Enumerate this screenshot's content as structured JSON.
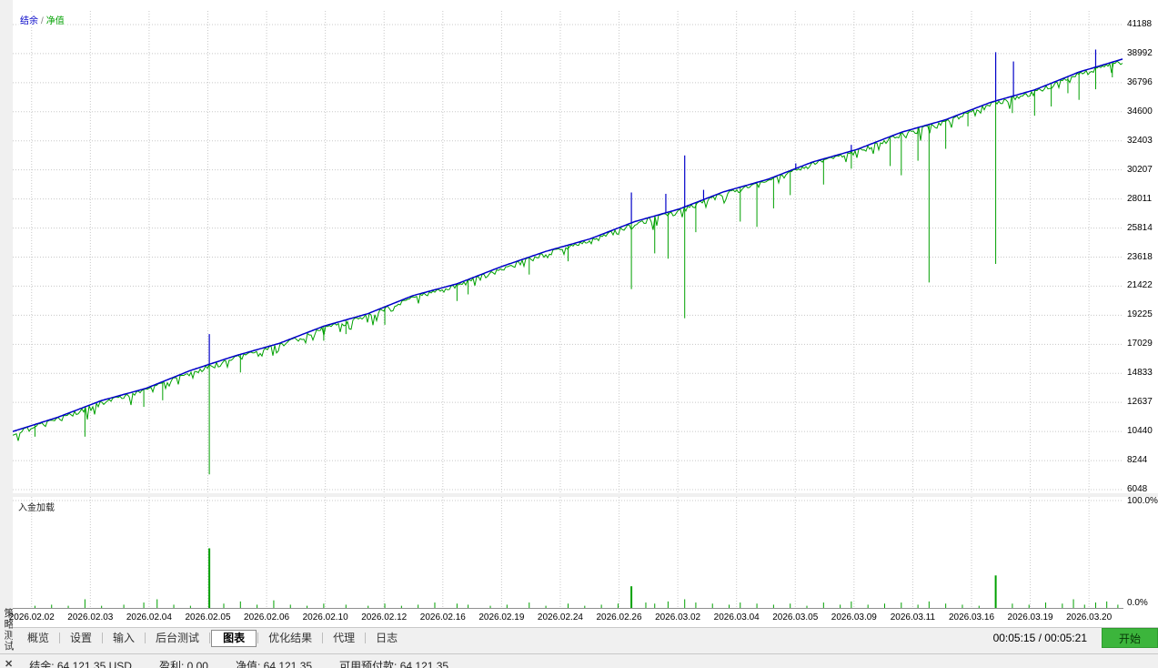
{
  "window": {
    "vertical_title": "策略测试"
  },
  "chart": {
    "legend": {
      "balance": "结余",
      "separator": "/",
      "equity": "净值"
    },
    "sub": {
      "label": "入金加载",
      "top": "100.0%",
      "bottom": "0.0%"
    }
  },
  "chart_data": [
    {
      "type": "line",
      "title": "结余 / 净值",
      "ylim": [
        6048,
        41188
      ],
      "yticks": [
        41188,
        38992,
        36796,
        34600,
        32403,
        30207,
        28011,
        25814,
        23618,
        21422,
        19225,
        17029,
        14833,
        12637,
        10440,
        8244,
        6048
      ],
      "x_labels": [
        "2026.02.02",
        "2026.02.03",
        "2026.02.04",
        "2026.02.05",
        "2026.02.06",
        "2026.02.10",
        "2026.02.12",
        "2026.02.16",
        "2026.02.19",
        "2026.02.24",
        "2026.02.26",
        "2026.03.02",
        "2026.03.04",
        "2026.03.05",
        "2026.03.09",
        "2026.03.11",
        "2026.03.16",
        "2026.03.19",
        "2026.03.20"
      ],
      "grid": true,
      "legend_position": "top-left",
      "series": [
        {
          "name": "结余",
          "color": "#0000C8",
          "points": [
            [
              0,
              10440
            ],
            [
              0.04,
              11500
            ],
            [
              0.08,
              12780
            ],
            [
              0.12,
              13700
            ],
            [
              0.16,
              15050
            ],
            [
              0.2,
              16150
            ],
            [
              0.24,
              17100
            ],
            [
              0.28,
              18400
            ],
            [
              0.32,
              19350
            ],
            [
              0.36,
              20700
            ],
            [
              0.4,
              21600
            ],
            [
              0.44,
              22900
            ],
            [
              0.48,
              24050
            ],
            [
              0.52,
              25000
            ],
            [
              0.56,
              26300
            ],
            [
              0.6,
              27250
            ],
            [
              0.64,
              28550
            ],
            [
              0.68,
              29500
            ],
            [
              0.72,
              30800
            ],
            [
              0.76,
              31750
            ],
            [
              0.8,
              33050
            ],
            [
              0.84,
              34000
            ],
            [
              0.88,
              35300
            ],
            [
              0.92,
              36250
            ],
            [
              0.96,
              37600
            ],
            [
              1,
              38600
            ]
          ],
          "up_spikes": [
            [
              0.177,
              17800
            ],
            [
              0.557,
              28500
            ],
            [
              0.588,
              28400
            ],
            [
              0.605,
              31300
            ],
            [
              0.622,
              28700
            ],
            [
              0.705,
              30700
            ],
            [
              0.755,
              32100
            ],
            [
              0.885,
              39100
            ],
            [
              0.901,
              38400
            ],
            [
              0.975,
              39300
            ]
          ]
        },
        {
          "name": "净值",
          "color": "#00A000",
          "down_spikes": [
            [
              0.02,
              10050
            ],
            [
              0.065,
              10050
            ],
            [
              0.118,
              12300
            ],
            [
              0.135,
              12800
            ],
            [
              0.177,
              7200
            ],
            [
              0.205,
              14900
            ],
            [
              0.28,
              17300
            ],
            [
              0.3,
              17800
            ],
            [
              0.335,
              18500
            ],
            [
              0.4,
              20300
            ],
            [
              0.41,
              20800
            ],
            [
              0.465,
              22300
            ],
            [
              0.5,
              23300
            ],
            [
              0.557,
              21200
            ],
            [
              0.578,
              23900
            ],
            [
              0.59,
              23500
            ],
            [
              0.605,
              19000
            ],
            [
              0.615,
              25500
            ],
            [
              0.655,
              26300
            ],
            [
              0.67,
              25900
            ],
            [
              0.685,
              27300
            ],
            [
              0.7,
              28300
            ],
            [
              0.73,
              29100
            ],
            [
              0.755,
              30300
            ],
            [
              0.79,
              30500
            ],
            [
              0.8,
              29800
            ],
            [
              0.815,
              30900
            ],
            [
              0.825,
              21700
            ],
            [
              0.84,
              31800
            ],
            [
              0.86,
              33500
            ],
            [
              0.885,
              23100
            ],
            [
              0.9,
              34500
            ],
            [
              0.92,
              34300
            ],
            [
              0.935,
              35000
            ],
            [
              0.95,
              36000
            ],
            [
              0.96,
              35500
            ],
            [
              0.975,
              36300
            ],
            [
              0.99,
              37200
            ]
          ],
          "jitter_max": 1100
        }
      ]
    },
    {
      "type": "bar",
      "title": "入金加载",
      "ylim": [
        0,
        100
      ],
      "ytick_labels": [
        "100.0%",
        "0.0%"
      ],
      "color": "#00A000",
      "bars": [
        [
          0.02,
          2
        ],
        [
          0.035,
          3
        ],
        [
          0.05,
          2
        ],
        [
          0.065,
          8
        ],
        [
          0.08,
          2
        ],
        [
          0.1,
          3
        ],
        [
          0.118,
          5
        ],
        [
          0.13,
          8
        ],
        [
          0.145,
          3
        ],
        [
          0.16,
          2
        ],
        [
          0.177,
          55
        ],
        [
          0.19,
          4
        ],
        [
          0.205,
          6
        ],
        [
          0.22,
          3
        ],
        [
          0.235,
          7
        ],
        [
          0.25,
          3
        ],
        [
          0.265,
          2
        ],
        [
          0.28,
          4
        ],
        [
          0.3,
          3
        ],
        [
          0.32,
          2
        ],
        [
          0.335,
          4
        ],
        [
          0.35,
          2
        ],
        [
          0.365,
          3
        ],
        [
          0.38,
          5
        ],
        [
          0.4,
          4
        ],
        [
          0.41,
          3
        ],
        [
          0.43,
          2
        ],
        [
          0.445,
          3
        ],
        [
          0.465,
          5
        ],
        [
          0.48,
          2
        ],
        [
          0.5,
          4
        ],
        [
          0.515,
          2
        ],
        [
          0.53,
          3
        ],
        [
          0.545,
          4
        ],
        [
          0.557,
          20
        ],
        [
          0.57,
          5
        ],
        [
          0.578,
          4
        ],
        [
          0.59,
          6
        ],
        [
          0.605,
          8
        ],
        [
          0.615,
          5
        ],
        [
          0.63,
          4
        ],
        [
          0.645,
          3
        ],
        [
          0.655,
          5
        ],
        [
          0.67,
          4
        ],
        [
          0.685,
          3
        ],
        [
          0.7,
          4
        ],
        [
          0.715,
          2
        ],
        [
          0.73,
          5
        ],
        [
          0.745,
          3
        ],
        [
          0.755,
          6
        ],
        [
          0.77,
          3
        ],
        [
          0.785,
          4
        ],
        [
          0.8,
          5
        ],
        [
          0.815,
          3
        ],
        [
          0.825,
          6
        ],
        [
          0.84,
          4
        ],
        [
          0.855,
          3
        ],
        [
          0.87,
          2
        ],
        [
          0.885,
          30
        ],
        [
          0.9,
          4
        ],
        [
          0.915,
          3
        ],
        [
          0.93,
          5
        ],
        [
          0.945,
          4
        ],
        [
          0.955,
          8
        ],
        [
          0.965,
          3
        ],
        [
          0.975,
          5
        ],
        [
          0.985,
          6
        ],
        [
          0.995,
          3
        ]
      ]
    }
  ],
  "tabs": {
    "items": [
      "概览",
      "设置",
      "输入",
      "后台测试",
      "图表",
      "优化结果",
      "代理",
      "日志"
    ],
    "active": "图表"
  },
  "controls": {
    "time": "00:05:15 / 00:05:21",
    "start_label": "开始",
    "start_color": "#3CB53C"
  },
  "statusbar": {
    "close_glyph": "✕",
    "items": [
      "结余: 64,121.35 USD",
      "盈利: 0.00",
      "净值: 64,121.35",
      "可用预付款: 64,121.35"
    ]
  }
}
